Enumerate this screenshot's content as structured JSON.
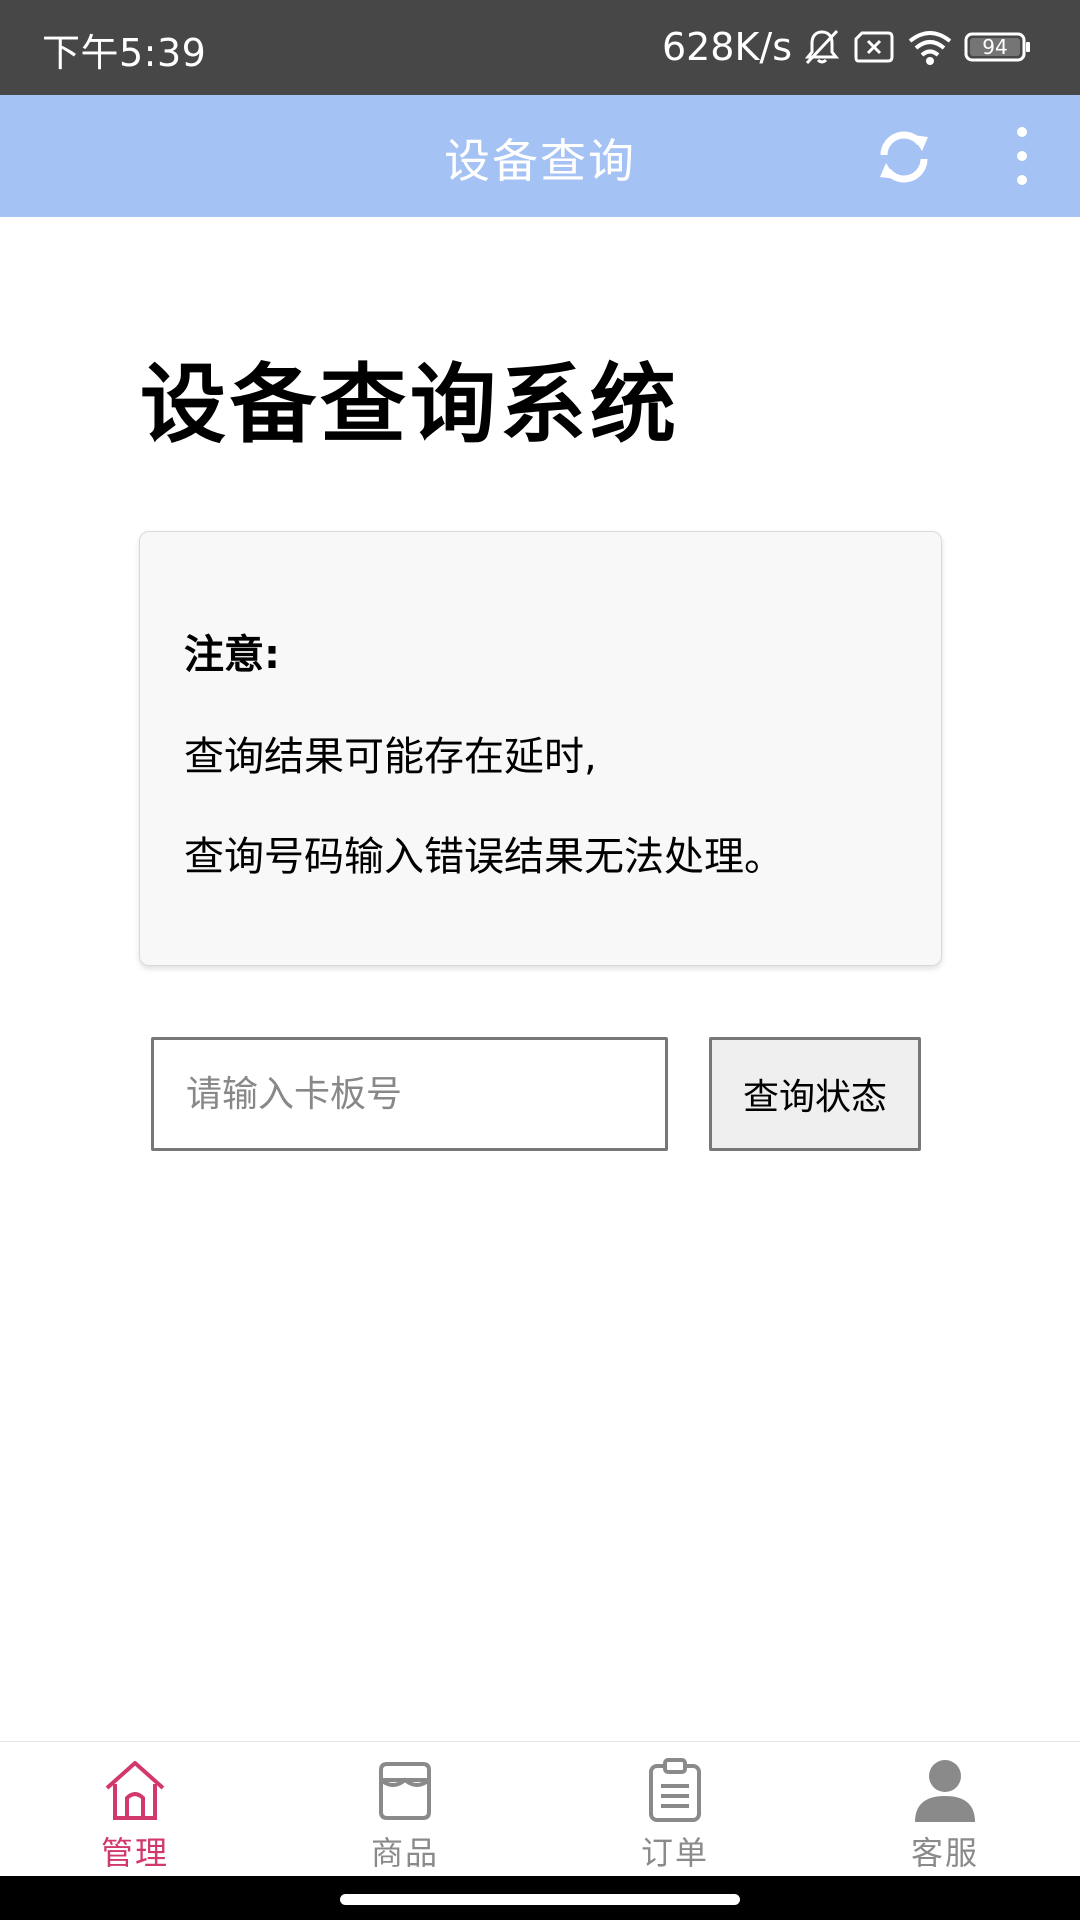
{
  "status_bar": {
    "time": "下午5:39",
    "net_speed": "628K/s",
    "battery": "94"
  },
  "app_bar": {
    "title": "设备查询",
    "refresh_icon": "refresh-icon",
    "more_icon": "more-vert-icon",
    "color": "#a4c2f4"
  },
  "main": {
    "heading": "设备查询系统",
    "notice": {
      "title": "注意:",
      "lines": [
        "查询结果可能存在延时,",
        "查询号码输入错误结果无法处理。"
      ]
    },
    "search": {
      "placeholder": "请输入卡板号",
      "value": "",
      "button_label": "查询状态"
    }
  },
  "bottom_nav": {
    "active_color": "#d2386b",
    "items": [
      {
        "label": "管理",
        "icon": "home-icon",
        "active": true
      },
      {
        "label": "商品",
        "icon": "store-icon",
        "active": false
      },
      {
        "label": "订单",
        "icon": "clipboard-icon",
        "active": false
      },
      {
        "label": "客服",
        "icon": "person-icon",
        "active": false
      }
    ]
  }
}
